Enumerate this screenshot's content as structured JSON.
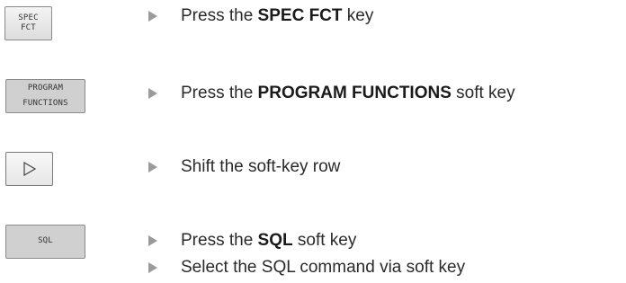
{
  "keys": {
    "spec_fct": {
      "line1": "SPEC",
      "line2": "FCT"
    },
    "program_functions": {
      "line1": "PROGRAM",
      "line2": "FUNCTIONS"
    },
    "shift_row": {
      "icon": "play-triangle-outline-icon"
    },
    "sql": {
      "label": "SQL"
    }
  },
  "steps": [
    {
      "pre": "Press the ",
      "bold": "SPEC FCT",
      "post": " key"
    },
    {
      "pre": "Press the ",
      "bold": "PROGRAM FUNCTIONS",
      "post": " soft key"
    },
    {
      "text": "Shift the soft-key row"
    },
    {
      "pre": "Press the ",
      "bold": "SQL",
      "post": " soft key"
    },
    {
      "text": "Select the SQL command via soft key"
    }
  ],
  "colors": {
    "bullet": "#9a9a9a",
    "key_border": "#8a8a8a",
    "softkey_fill": "#d0d0d0"
  }
}
